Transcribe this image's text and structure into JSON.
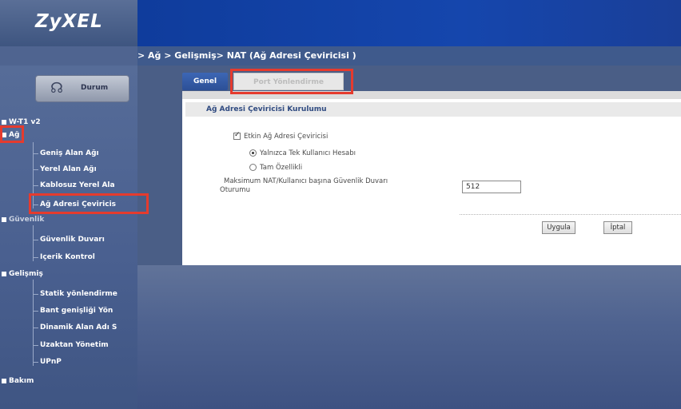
{
  "header": {
    "logo": "ZyXEL"
  },
  "breadcrumb": "> Ağ > Gelişmiş> NAT (Ağ Adresi Çeviricisi )",
  "sidebar": {
    "status_button": {
      "label": "Durum",
      "icon": "monitor-icon"
    },
    "device": "W-T1 v2",
    "sections": [
      {
        "label": "Ağ",
        "items": [
          "Geniş Alan Ağı",
          "Yerel Alan Ağı",
          "Kablosuz Yerel Ala",
          "Ağ Adresi Çeviricis"
        ]
      },
      {
        "label": "Güvenlik",
        "items": [
          "Güvenlik Duvarı",
          "İçerik Kontrol"
        ]
      },
      {
        "label": "Gelişmiş",
        "items": [
          "Statik yönlendirme",
          "Bant genişliği Yön",
          "Dinamik Alan Adı S",
          "Uzaktan Yönetim",
          "UPnP"
        ]
      },
      {
        "label": "Bakım",
        "items": []
      }
    ]
  },
  "tabs": [
    {
      "label": "Genel",
      "active": true
    },
    {
      "label": "Port Yönlendirme",
      "active": false
    }
  ],
  "form": {
    "section_title": "Ağ Adresi Çeviricisi Kurulumu",
    "enable_nat": {
      "label": "Etkin Ağ Adresi Çeviricisi",
      "checked": true
    },
    "mode_options": [
      {
        "label": "Yalnızca Tek Kullanıcı Hesabı",
        "selected": true
      },
      {
        "label": "Tam Özellikli",
        "selected": false
      }
    ],
    "max_sessions": {
      "label_line1": "Maksimum NAT/Kullanıcı başına Güvenlik Duvarı",
      "label_line2": "Oturumu",
      "value": "512"
    },
    "apply_label": "Uygula",
    "cancel_label": "İptal"
  },
  "colors": {
    "highlight": "#e53b2e",
    "header_blue": "#1546ad",
    "sidebar": "#4a6090"
  }
}
